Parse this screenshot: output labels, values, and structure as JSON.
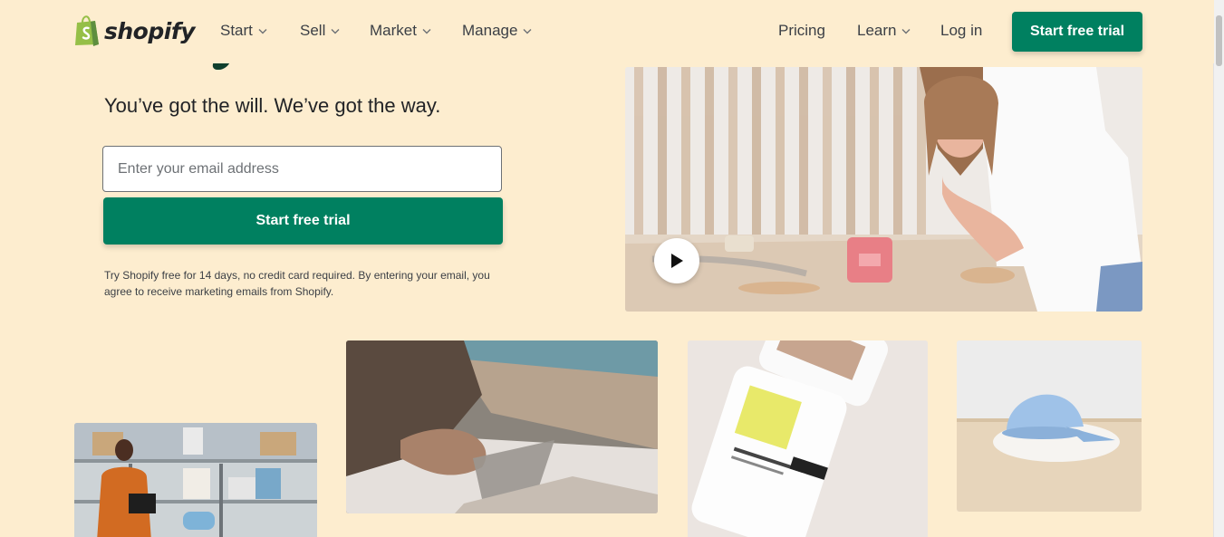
{
  "header": {
    "logo_text": "shopify",
    "nav": [
      {
        "label": "Start"
      },
      {
        "label": "Sell"
      },
      {
        "label": "Market"
      },
      {
        "label": "Manage"
      }
    ],
    "right_nav": {
      "pricing": "Pricing",
      "learn": "Learn",
      "login": "Log in"
    },
    "cta_label": "Start free trial"
  },
  "hero": {
    "tagline": "You’ve got the will. We’ve got the way.",
    "email_placeholder": "Enter your email address",
    "cta_label": "Start free trial",
    "disclaimer": "Try Shopify free for 14 days, no credit card required. By entering your email, you agree to receive marketing emails from Shopify."
  },
  "colors": {
    "background": "#fdedcf",
    "brand_green": "#008060",
    "logo_green": "#95bf47"
  },
  "icons": {
    "logo": "shopify-bag-icon",
    "dropdown": "chevron-down-icon",
    "play": "play-icon"
  }
}
